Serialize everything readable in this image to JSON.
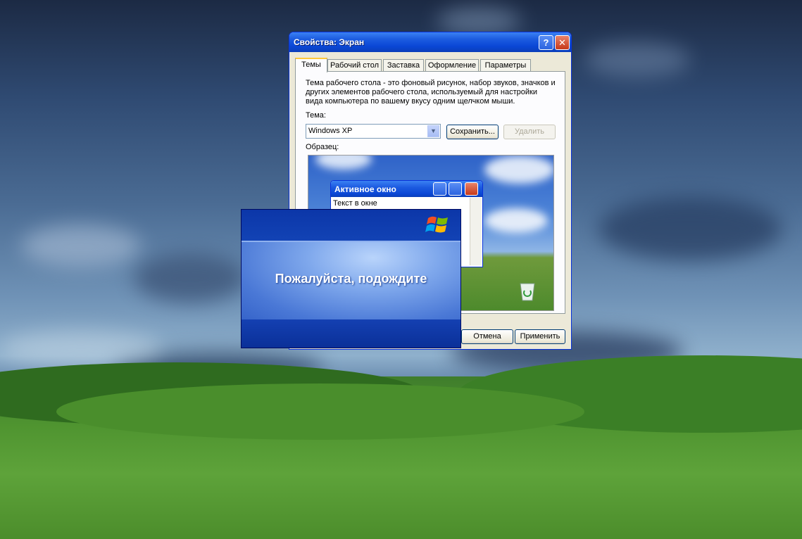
{
  "window": {
    "title": "Свойства: Экран",
    "help_symbol": "?",
    "close_symbol": "✕"
  },
  "tabs": [
    {
      "label": "Темы",
      "active": true
    },
    {
      "label": "Рабочий стол",
      "active": false
    },
    {
      "label": "Заставка",
      "active": false
    },
    {
      "label": "Оформление",
      "active": false
    },
    {
      "label": "Параметры",
      "active": false
    }
  ],
  "themes_tab": {
    "description": "Тема рабочего стола - это фоновый рисунок, набор звуков, значков и других элементов рабочего стола, используемый для настройки вида компьютера по вашему вкусу одним щелчком мыши.",
    "theme_label": "Тема:",
    "theme_value": "Windows XP",
    "save_button": "Сохранить...",
    "delete_button": "Удалить",
    "sample_label": "Образец:"
  },
  "preview": {
    "window_title": "Активное окно",
    "window_text": "Текст в окне"
  },
  "footer": {
    "cancel_button": "Отмена",
    "apply_button": "Применить"
  },
  "splash": {
    "message": "Пожалуйста, подождите"
  },
  "colors": {
    "titlebar_blue": "#0a47d6",
    "dialog_bg": "#ece9d8",
    "tab_highlight": "#ffc83c",
    "splash_blue": "#0b3aa3"
  }
}
